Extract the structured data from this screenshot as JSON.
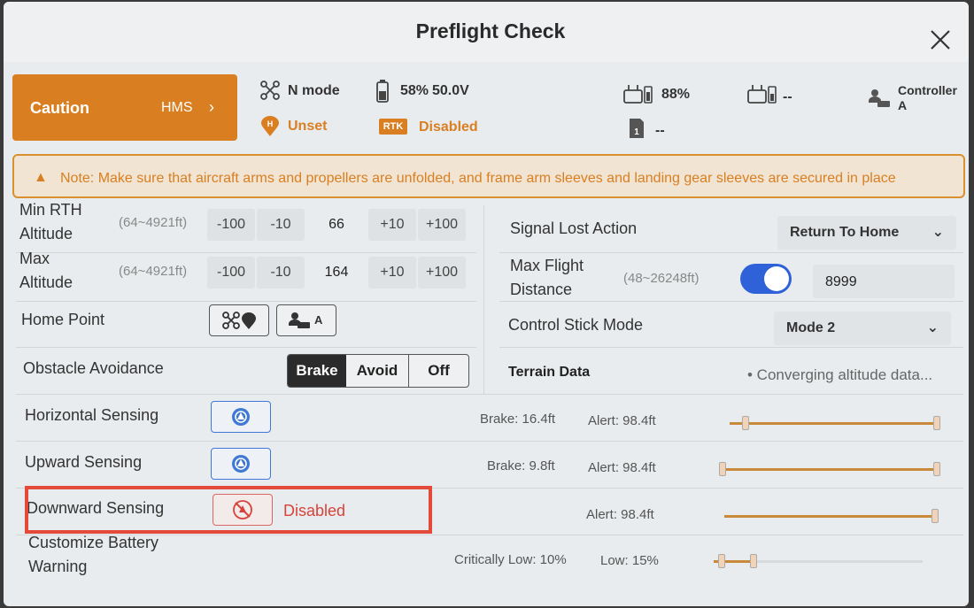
{
  "title": "Preflight Check",
  "status": {
    "caution_label": "Caution",
    "hms_label": "HMS",
    "flight_mode": "N mode",
    "battery": "58%",
    "voltage": "50.0V",
    "home_point": "Unset",
    "rtk_badge": "RTK",
    "rtk_status": "Disabled",
    "rc_battery": "88%",
    "remote_battery": "--",
    "sd_card": "--",
    "controller": "Controller A"
  },
  "note": "Note: Make sure that aircraft arms and propellers are unfolded, and frame arm sleeves and landing gear sleeves are secured in place",
  "left": {
    "min_rth": {
      "label": "Min RTH Altitude",
      "range": "(64~4921ft)",
      "minus100": "-100",
      "minus10": "-10",
      "value": "66",
      "plus10": "+10",
      "plus100": "+100"
    },
    "max_alt": {
      "label": "Max Altitude",
      "range": "(64~4921ft)",
      "minus100": "-100",
      "minus10": "-10",
      "value": "164",
      "plus10": "+10",
      "plus100": "+100"
    },
    "home_point": {
      "label": "Home Point",
      "controller_suffix": "A"
    },
    "obstacle": {
      "label": "Obstacle Avoidance",
      "options": [
        "Brake",
        "Avoid",
        "Off"
      ],
      "selected": "Brake"
    },
    "horizontal": {
      "label": "Horizontal Sensing"
    },
    "upward": {
      "label": "Upward Sensing"
    },
    "downward": {
      "label": "Downward Sensing",
      "status": "Disabled"
    },
    "battery": {
      "label": "Customize Battery Warning"
    }
  },
  "right": {
    "signal_lost": {
      "label": "Signal Lost Action",
      "value": "Return To Home"
    },
    "max_distance": {
      "label": "Max Flight Distance",
      "range": "(48~26248ft)",
      "enabled": true,
      "value": "8999"
    },
    "stick_mode": {
      "label": "Control Stick Mode",
      "value": "Mode 2"
    },
    "terrain": {
      "label": "Terrain Data",
      "status": "• Converging altitude data..."
    },
    "horizontal": {
      "brake": "Brake: 16.4ft",
      "alert": "Alert: 98.4ft",
      "brake_frac": 0.06,
      "alert_frac": 1.0
    },
    "upward": {
      "brake": "Brake: 9.8ft",
      "alert": "Alert: 98.4ft",
      "brake_frac": 0.0,
      "alert_frac": 1.0
    },
    "downward": {
      "alert": "Alert: 98.4ft",
      "alert_frac": 1.0
    },
    "battery": {
      "critical": "Critically Low: 10%",
      "low": "Low: 15%",
      "critical_frac": 0.02,
      "low_frac": 0.18
    }
  },
  "colors": {
    "accent": "#d97f22",
    "toggle": "#2f62d8",
    "highlight": "#e34a3a",
    "sensing": "#3f79d4"
  }
}
